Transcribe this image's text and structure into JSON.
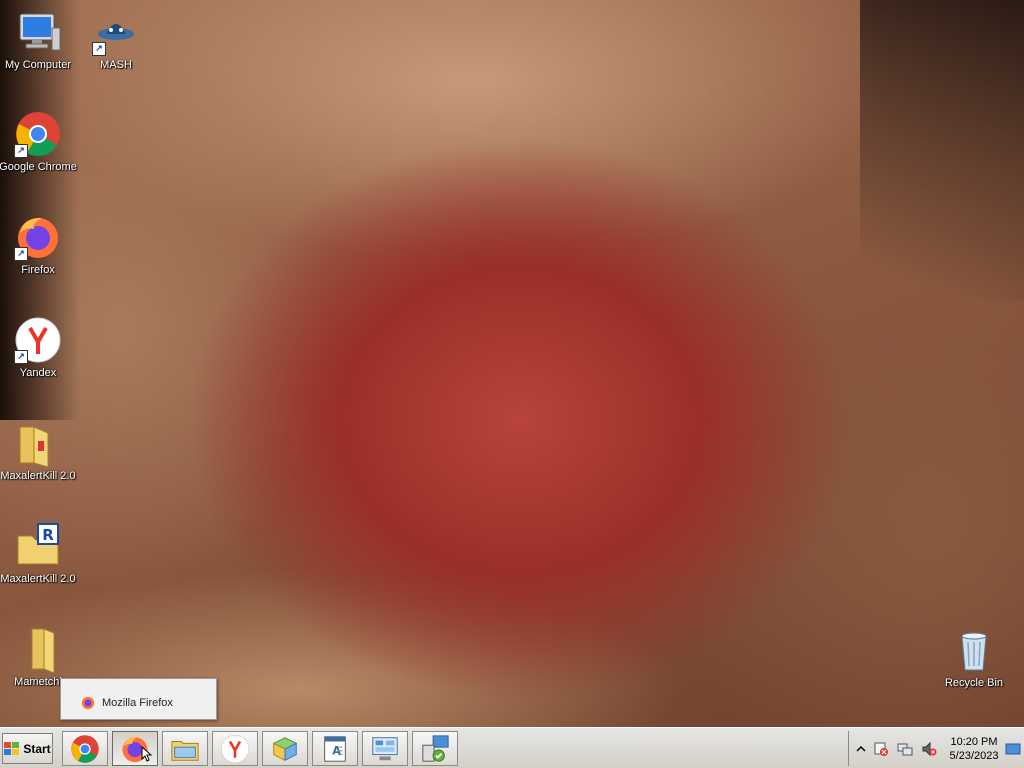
{
  "desktop": {
    "icons": [
      {
        "label": "My Computer",
        "icon": "computer-icon"
      },
      {
        "label": "MASH",
        "icon": "mash-icon"
      },
      {
        "label": "Google Chrome",
        "icon": "chrome-icon"
      },
      {
        "label": "Firefox",
        "icon": "firefox-icon"
      },
      {
        "label": "Yandex",
        "icon": "yandex-icon"
      },
      {
        "label": "MaxalertKill 2.0",
        "icon": "folder-icon"
      },
      {
        "label": "MaxalertKill 2.0",
        "icon": "installer-icon"
      },
      {
        "label": "Mametchi",
        "icon": "folder-icon"
      },
      {
        "label": "Recycle Bin",
        "icon": "recycle-bin-icon"
      }
    ]
  },
  "popup": {
    "item_label": "Mozilla Firefox"
  },
  "taskbar": {
    "start_label": "Start",
    "buttons": [
      {
        "icon": "chrome-icon"
      },
      {
        "icon": "firefox-icon"
      },
      {
        "icon": "explorer-icon"
      },
      {
        "icon": "yandex-icon"
      },
      {
        "icon": "app-icon"
      },
      {
        "icon": "document-icon"
      },
      {
        "icon": "control-panel-icon"
      },
      {
        "icon": "network-setup-icon"
      }
    ]
  },
  "tray": {
    "time": "10:20 PM",
    "date": "5/23/2023"
  },
  "colors": {
    "taskbar_bg": "#d4d0c8",
    "label_text": "#ffffff"
  }
}
